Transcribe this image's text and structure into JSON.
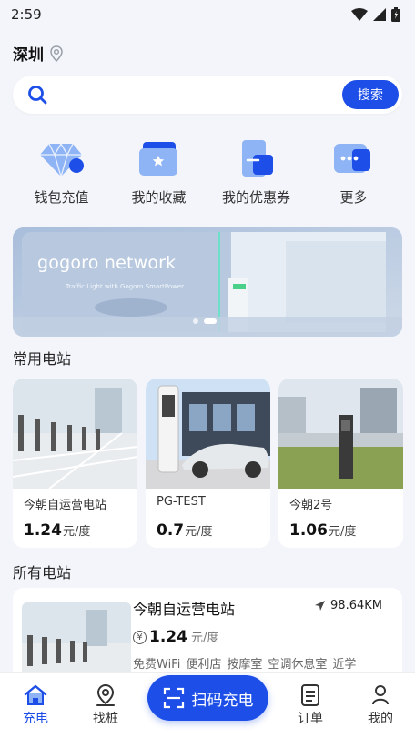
{
  "status": {
    "time": "2:59"
  },
  "location": {
    "city": "深圳",
    "icon": "location-pin-icon"
  },
  "search": {
    "placeholder": "",
    "button": "搜索"
  },
  "quick_actions": [
    {
      "label": "钱包充值",
      "icon": "diamond-wallet-icon"
    },
    {
      "label": "我的收藏",
      "icon": "star-folder-icon"
    },
    {
      "label": "我的优惠券",
      "icon": "coupon-icon"
    },
    {
      "label": "更多",
      "icon": "more-dots-icon"
    }
  ],
  "banner": {
    "title": "gogoro network",
    "subtitle": "Traffic Light with Gogoro SmartPower"
  },
  "sections": {
    "favorites": "常用电站",
    "all": "所有电站"
  },
  "favorites": [
    {
      "name": "今朝自运营电站",
      "price": "1.24",
      "unit": "元/度"
    },
    {
      "name": "PG-TEST",
      "price": "0.7",
      "unit": "元/度"
    },
    {
      "name": "今朝2号",
      "price": "1.06",
      "unit": "元/度"
    }
  ],
  "station": {
    "name": "今朝自运营电站",
    "distance": "98.64KM",
    "currency": "¥",
    "price": "1.24",
    "unit": "元/度",
    "tags": [
      "免费WiFi",
      "便利店",
      "按摩室",
      "空调休息室",
      "近学"
    ]
  },
  "tabs": [
    {
      "label": "充电",
      "icon": "home-icon"
    },
    {
      "label": "找桩",
      "icon": "map-pin-icon"
    },
    {
      "label": "订单",
      "icon": "order-list-icon"
    },
    {
      "label": "我的",
      "icon": "profile-icon"
    }
  ],
  "scan": {
    "label": "扫码充电",
    "icon": "scan-icon"
  },
  "colors": {
    "primary": "#1d4fe8",
    "background": "#f3f5fa"
  }
}
